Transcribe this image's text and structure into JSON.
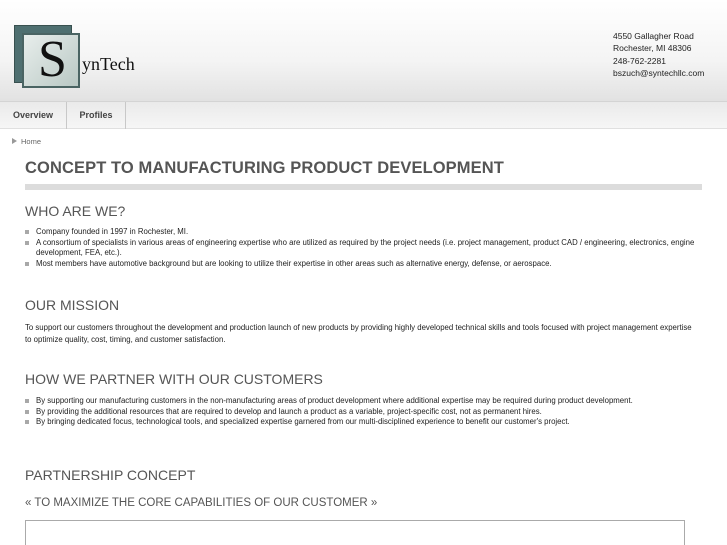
{
  "header": {
    "logo_letter": "S",
    "logo_rest": "ynTech",
    "contact": [
      "4550 Gallagher Road",
      "Rochester, MI 48306",
      "248-762-2281",
      "bszuch@syntechllc.com"
    ]
  },
  "nav": {
    "tabs": [
      "Overview",
      "Profiles"
    ]
  },
  "breadcrumb": "Home",
  "main": {
    "title": "CONCEPT TO MANUFACTURING PRODUCT DEVELOPMENT",
    "who": {
      "heading": "WHO ARE WE?",
      "items": [
        "Company founded in 1997 in Rochester, MI.",
        "A consortium of specialists in various areas of engineering expertise who are utilized as required by the project needs (i.e. project management, product CAD / engineering, electronics, engine development, FEA, etc.).",
        "Most members have automotive background but are looking to utilize their expertise in other areas such as alternative energy, defense, or aerospace."
      ]
    },
    "mission": {
      "heading": "OUR MISSION",
      "text": "To support our customers throughout the development and production launch of new products by providing highly developed technical skills and tools focused with project management expertise to optimize quality, cost, timing, and customer satisfaction."
    },
    "partner": {
      "heading": "HOW WE PARTNER WITH OUR CUSTOMERS",
      "items": [
        "By supporting our manufacturing customers in the non-manufacturing areas of product development where additional expertise may be required during product development.",
        "By providing the additional resources that are required to develop and launch a product as a variable, project-specific cost, not as permanent hires.",
        "By bringing dedicated focus, technological tools, and specialized expertise garnered from our multi-disciplined experience to benefit our customer's project."
      ]
    },
    "concept": {
      "heading": "PARTNERSHIP CONCEPT",
      "quote": "« TO MAXIMIZE THE CORE CAPABILITIES OF OUR CUSTOMER »"
    }
  }
}
